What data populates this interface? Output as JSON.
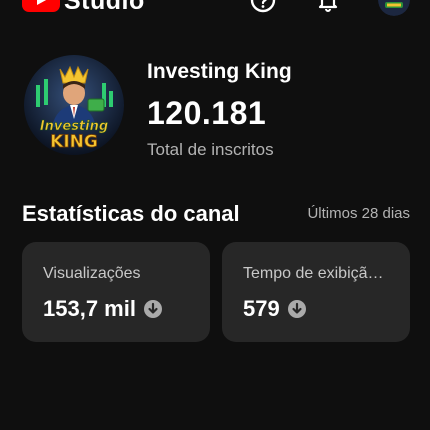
{
  "header": {
    "logo_icon": "youtube-logo-icon",
    "app_name": "Studio",
    "help_icon": "help-circle-icon",
    "notifications_icon": "bell-icon",
    "account_avatar": "avatar-icon"
  },
  "channel": {
    "avatar_icon": "channel-avatar",
    "name": "Investing King",
    "subscriber_count": "120.181",
    "subscriber_label": "Total de inscritos"
  },
  "stats": {
    "title": "Estatísticas do canal",
    "period": "Últimos 28 dias",
    "cards": [
      {
        "label": "Visualizações",
        "value": "153,7 mil",
        "trend_icon": "arrow-down-circle-icon"
      },
      {
        "label": "Tempo de exibiçã…",
        "value": "579",
        "trend_icon": "arrow-down-circle-icon"
      }
    ]
  },
  "colors": {
    "background": "#0f0f0f",
    "card": "#272727",
    "brand_red": "#ff0000",
    "secondary_text": "#b3b3b3"
  }
}
